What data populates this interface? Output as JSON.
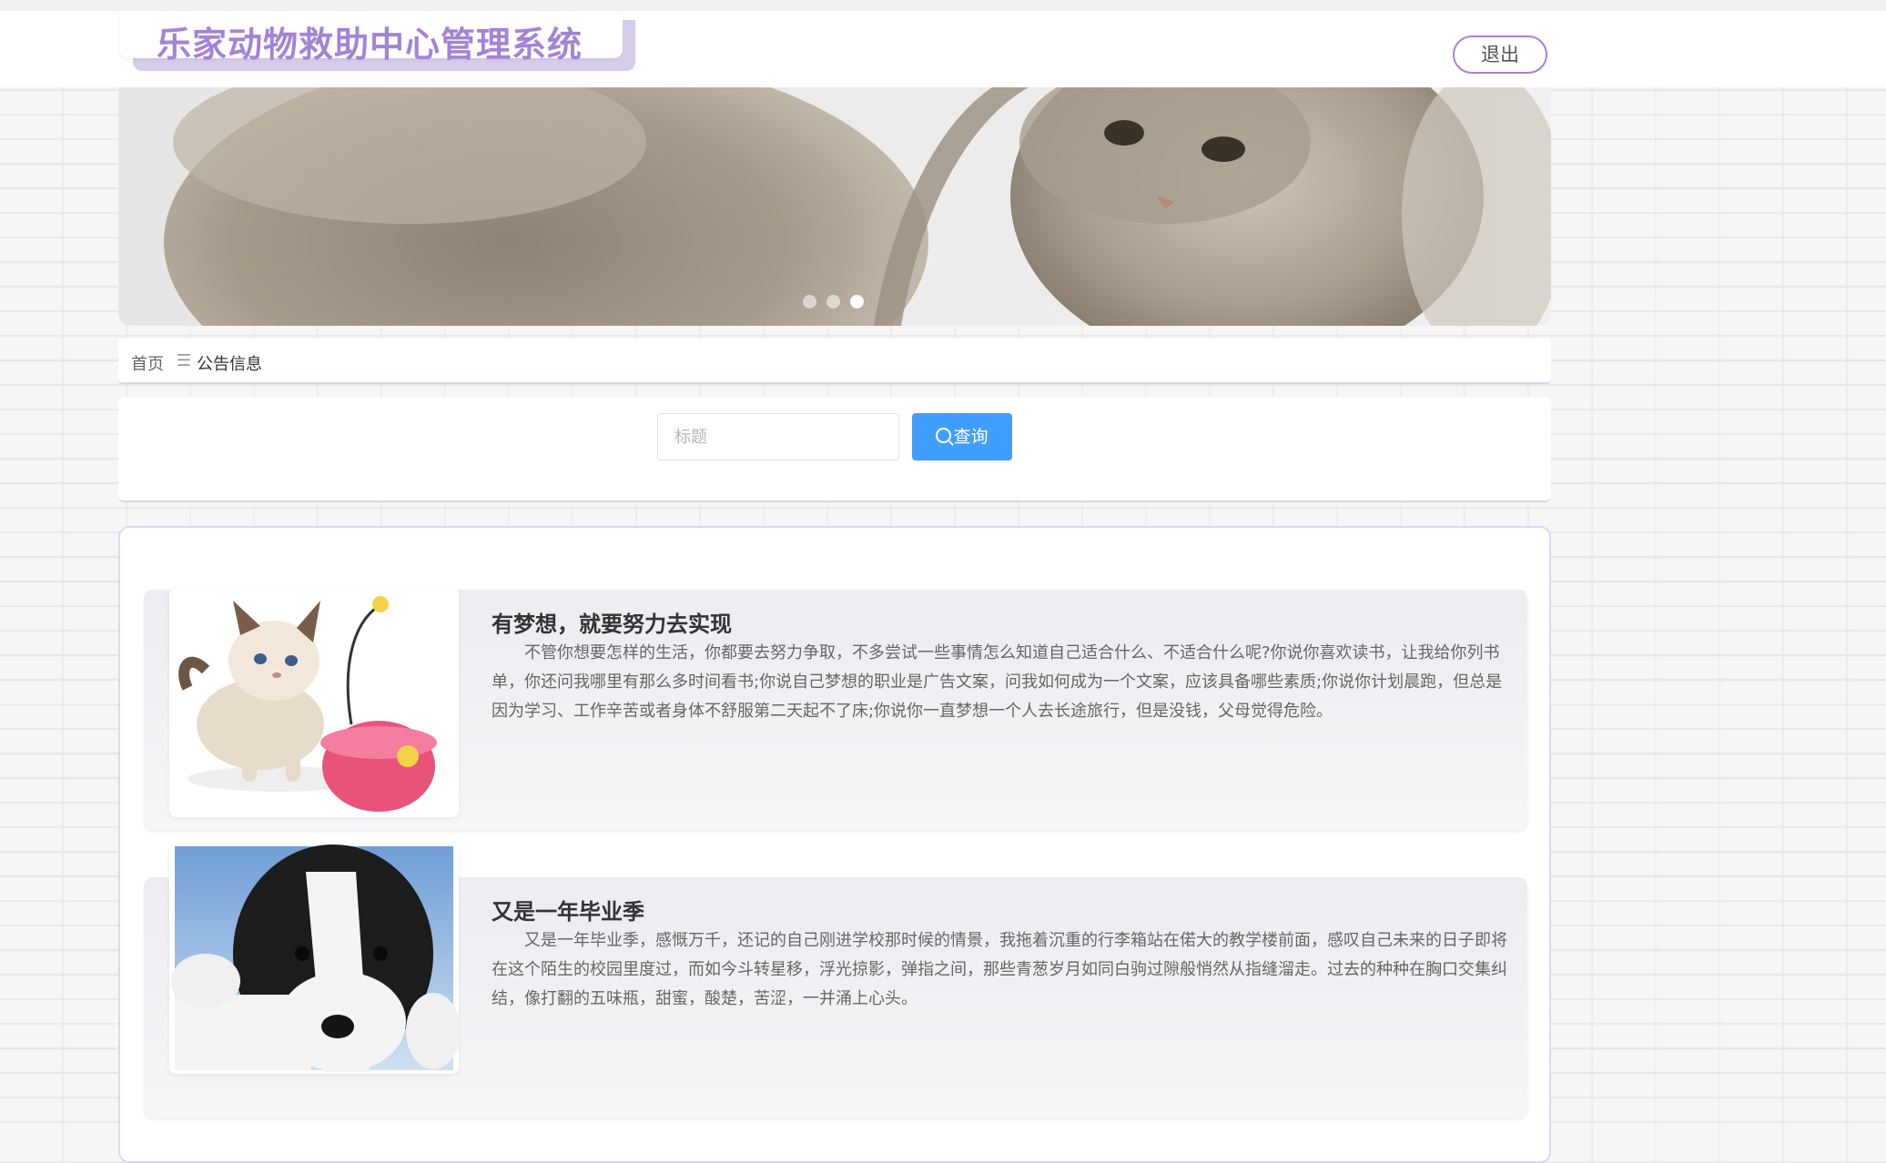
{
  "header": {
    "system_title": "乐家动物救助中心管理系统",
    "logout_label": "退出"
  },
  "banner": {
    "slide_count": 3,
    "active_slide": 3
  },
  "breadcrumb": {
    "home": "首页",
    "separator": "☰",
    "current": "公告信息"
  },
  "search": {
    "placeholder": "标题",
    "button_label": "查询"
  },
  "notices": [
    {
      "title": "有梦想，就要努力去实现",
      "content": "不管你想要怎样的生活，你都要去努力争取，不多尝试一些事情怎么知道自己适合什么、不适合什么呢?你说你喜欢读书，让我给你列书单，你还问我哪里有那么多时间看书;你说自己梦想的职业是广告文案，问我如何成为一个文案，应该具备哪些素质;你说你计划晨跑，但总是因为学习、工作辛苦或者身体不舒服第二天起不了床;你说你一直梦想一个人去长途旅行，但是没钱，父母觉得危险。",
      "image": "kitten-with-toy"
    },
    {
      "title": "又是一年毕业季",
      "content": "又是一年毕业季，感慨万千，还记的自己刚进学校那时候的情景，我拖着沉重的行李箱站在偌大的教学楼前面，感叹自己未来的日子即将在这个陌生的校园里度过，而如今斗转星移，浮光掠影，弹指之间，那些青葱岁月如同白驹过隙般悄然从指缝溜走。过去的种种在胸口交集纠结，像打翻的五味瓶，甜蜜，酸楚，苦涩，一并涌上心头。",
      "image": "black-white-puppy"
    }
  ],
  "colors": {
    "brand_purple": "#a483d6",
    "button_blue": "#409eff"
  }
}
